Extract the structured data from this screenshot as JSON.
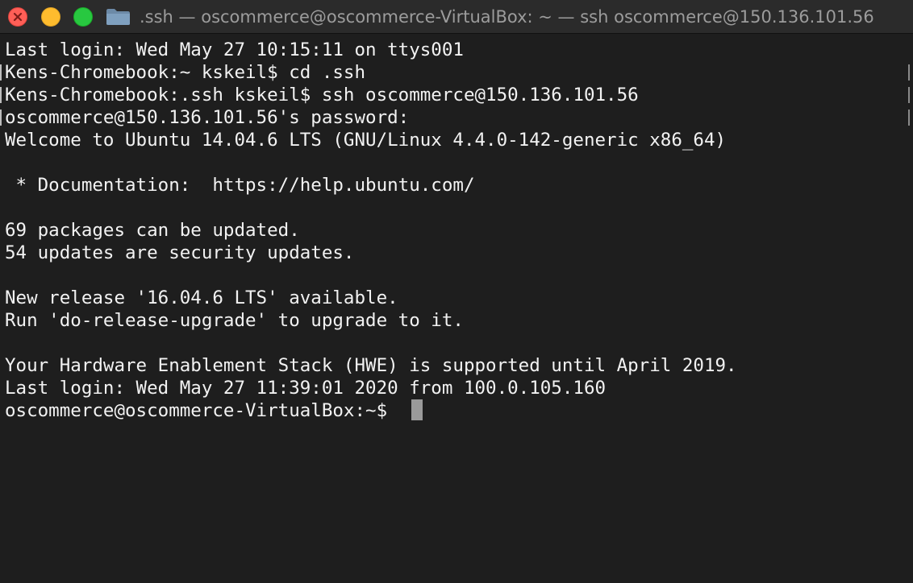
{
  "window": {
    "title": ".ssh — oscommerce@oscommerce-VirtualBox: ~ — ssh oscommerce@150.136.101.56",
    "title_icon": "folder-icon",
    "controls": {
      "close_icon": "close-icon",
      "minimize_icon": "minimize-icon",
      "maximize_icon": "maximize-icon"
    }
  },
  "terminal": {
    "lines": [
      "Last login: Wed May 27 10:15:11 on ttys001",
      "Kens-Chromebook:~ kskeil$ cd .ssh",
      "Kens-Chromebook:.ssh kskeil$ ssh oscommerce@150.136.101.56",
      "oscommerce@150.136.101.56's password:",
      "Welcome to Ubuntu 14.04.6 LTS (GNU/Linux 4.4.0-142-generic x86_64)",
      "",
      " * Documentation:  https://help.ubuntu.com/",
      "",
      "69 packages can be updated.",
      "54 updates are security updates.",
      "",
      "New release '16.04.6 LTS' available.",
      "Run 'do-release-upgrade' to upgrade to it.",
      "",
      "Your Hardware Enablement Stack (HWE) is supported until April 2019.",
      "Last login: Wed May 27 11:39:01 2020 from 100.0.105.160",
      "oscommerce@oscommerce-VirtualBox:~$ "
    ],
    "cursor_icon": "terminal-cursor-icon"
  },
  "colors": {
    "background": "#1e1e1e",
    "titlebar": "#2b2b2b",
    "text": "#f2f2f2",
    "title_text": "#9c9c9c",
    "close": "#ff5f57",
    "minimize": "#febc2e",
    "maximize": "#28c840",
    "folder": "#6c8aa7"
  }
}
